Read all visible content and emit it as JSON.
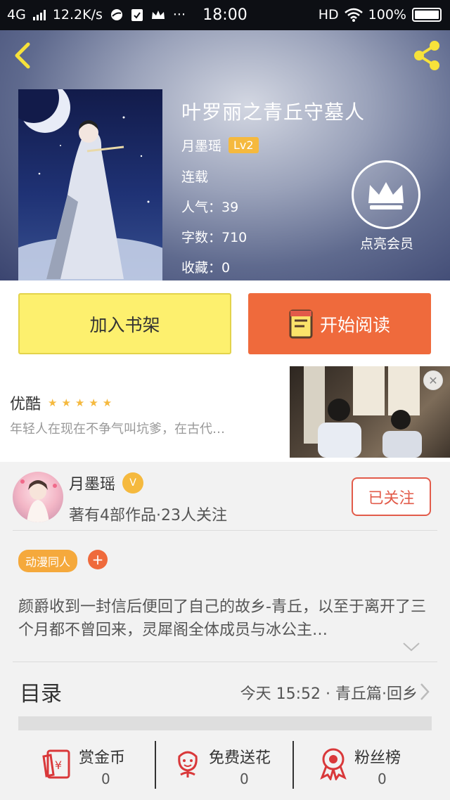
{
  "status_bar": {
    "network": "4G",
    "speed": "12.2K/s",
    "time": "18:00",
    "hd": "HD",
    "battery": "100%"
  },
  "book": {
    "title": "叶罗丽之青丘守墓人",
    "author": "月墨瑶",
    "level": "Lv2",
    "status": "连载",
    "popularity": "人气：39",
    "word_count": "字数：710",
    "favorites": "收藏：0"
  },
  "vip": {
    "label": "点亮会员",
    "icon": "crown-icon"
  },
  "actions": {
    "add_shelf": "加入书架",
    "start_reading": "开始阅读"
  },
  "ad": {
    "brand": "优酷",
    "stars": "★★★★★",
    "description": "年轻人在现在不争气叫坑爹，在古代…"
  },
  "author_card": {
    "name": "月墨瑶",
    "stats": "著有4部作品·23人关注",
    "follow": "已关注"
  },
  "tag": {
    "label": "动漫同人",
    "add": "+"
  },
  "synopsis": "颜爵收到一封信后便回了自己的故乡-青丘，以至于离开了三个月都不曾回来，灵犀阁全体成员与冰公主…",
  "toc": {
    "title": "目录",
    "latest": "今天 15:52 · 青丘篇·回乡"
  },
  "tools": [
    {
      "label": "赏金币",
      "value": "0",
      "icon": "reward-coin-icon"
    },
    {
      "label": "免费送花",
      "value": "0",
      "icon": "flower-icon"
    },
    {
      "label": "粉丝榜",
      "value": "0",
      "icon": "medal-icon"
    }
  ],
  "colors": {
    "accent_orange": "#ef6a3c",
    "shelf_yellow": "#fdf06e",
    "badge_gold": "#f5b93e",
    "follow_red": "#e25b4a"
  }
}
